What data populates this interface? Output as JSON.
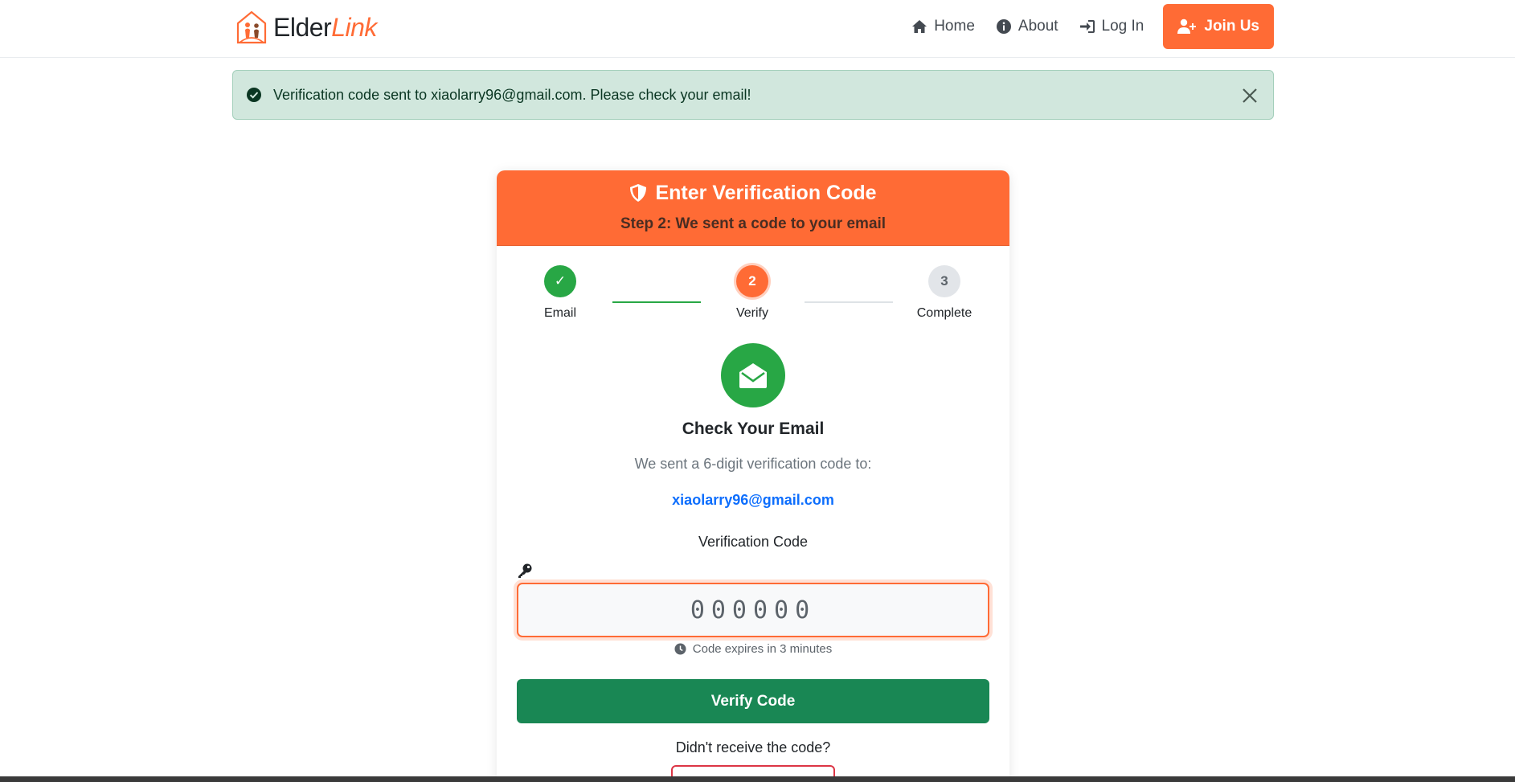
{
  "brand": {
    "name_part1": "Elder",
    "name_part2": "Link"
  },
  "nav": {
    "home": "Home",
    "about": "About",
    "login": "Log In",
    "join": "Join Us"
  },
  "alert": {
    "message": "Verification code sent to xiaolarry96@gmail.com. Please check your email!",
    "color": "#d1e7dd"
  },
  "card": {
    "title": "Enter Verification Code",
    "subtitle": "Step 2: We sent a code to your email",
    "header_color": "#ff6b35"
  },
  "stepper": {
    "steps": [
      {
        "number": "✓",
        "label": "Email",
        "state": "done"
      },
      {
        "number": "2",
        "label": "Verify",
        "state": "active"
      },
      {
        "number": "3",
        "label": "Complete",
        "state": "todo"
      }
    ]
  },
  "main": {
    "check_title": "Check Your Email",
    "sent_text": "We sent a 6-digit verification code to:",
    "email": "xiaolarry96@gmail.com",
    "code_label": "Verification Code",
    "code_placeholder": "000000",
    "code_value": "",
    "expires_text": "Code expires in 3 minutes",
    "verify_button": "Verify Code",
    "didnt_receive": "Didn't receive the code?"
  },
  "colors": {
    "accent": "#ff6b35",
    "success": "#28a745",
    "verify": "#198754",
    "link": "#0d6efd",
    "resend_border": "#dc3545"
  }
}
